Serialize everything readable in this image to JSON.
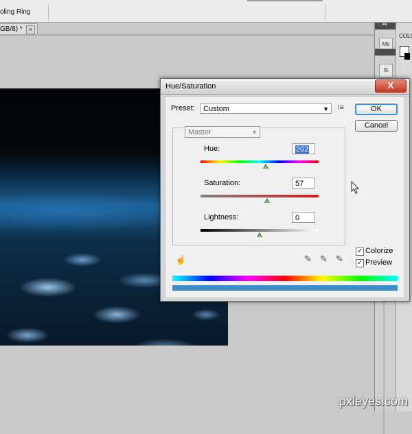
{
  "optionsBar": {
    "label": "oling Ring"
  },
  "docTab": {
    "label": "GB/8) *",
    "close": "×"
  },
  "rightDock": {
    "icon1": "Mb",
    "icon2": "I5",
    "collapse": "◂◂"
  },
  "farRight": {
    "label": "COLO"
  },
  "dialog": {
    "title": "Hue/Saturation",
    "close": "X",
    "preset": {
      "label": "Preset:",
      "value": "Custom"
    },
    "presetMenuIcon": "⁝≡",
    "okLabel": "OK",
    "cancelLabel": "Cancel",
    "channel": {
      "value": "Master"
    },
    "hue": {
      "label": "Hue:",
      "value": "202",
      "position": 0.56
    },
    "saturation": {
      "label": "Saturation:",
      "value": "57",
      "position": 0.64
    },
    "lightness": {
      "label": "Lightness:",
      "value": "0",
      "position": 0.5
    },
    "colorize": {
      "label": "Colorize",
      "checked": true
    },
    "preview": {
      "label": "Preview",
      "checked": true
    }
  },
  "watermark": "pxleyes.com",
  "colors": {
    "accent": "#3c8fd6",
    "closeRed": "#c23a23",
    "tintBar": "#3d8fcb"
  }
}
